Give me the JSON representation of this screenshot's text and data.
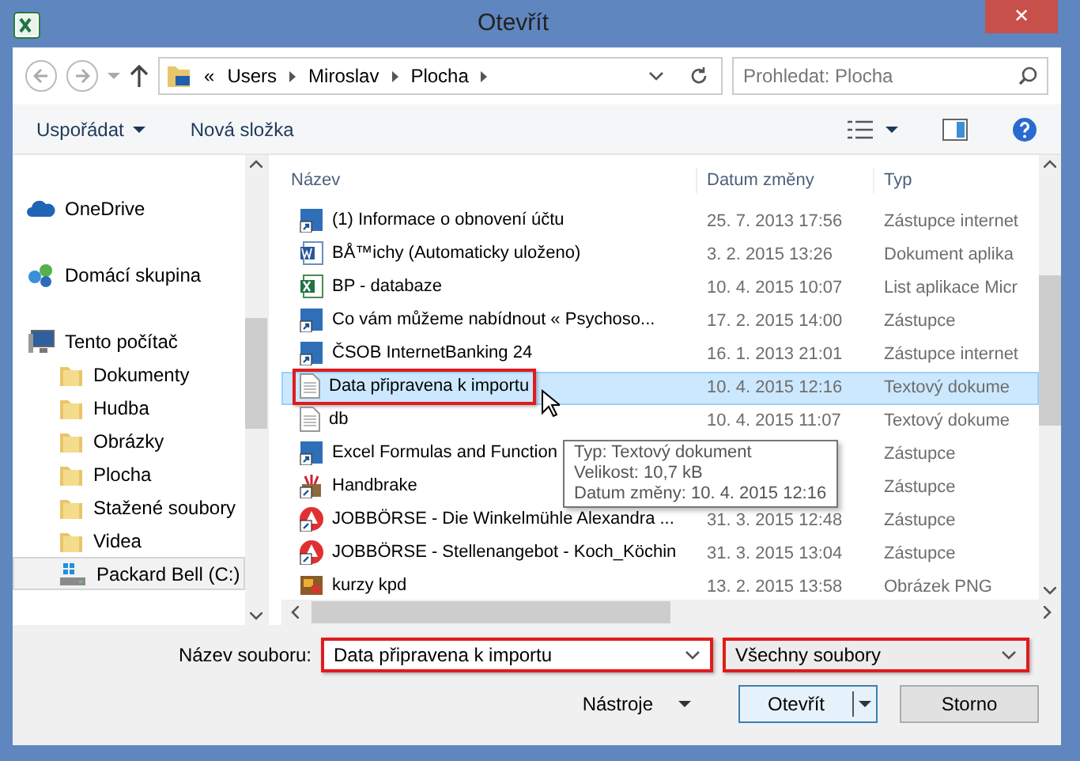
{
  "window": {
    "title": "Otevřít",
    "close": "✕"
  },
  "nav": {
    "path": [
      "Users",
      "Miroslav",
      "Plocha"
    ],
    "overflow": "«",
    "search": {
      "placeholder": "Prohledat: Plocha"
    }
  },
  "commands": [
    {
      "label": "Uspořádat",
      "dropdown": true
    },
    {
      "label": "Nová složka",
      "dropdown": false
    }
  ],
  "sidebar": {
    "items": [
      {
        "label": "OneDrive",
        "kind": "cloud",
        "selected": false
      },
      {
        "label": "Domácí skupina",
        "kind": "homegroup",
        "selected": false
      },
      {
        "label": "Tento počítač",
        "kind": "computer",
        "selected": false,
        "children": [
          {
            "label": "Dokumenty",
            "kind": "folder",
            "selected": false
          },
          {
            "label": "Hudba",
            "kind": "folder",
            "selected": false
          },
          {
            "label": "Obrázky",
            "kind": "folder",
            "selected": false
          },
          {
            "label": "Plocha",
            "kind": "folder",
            "selected": false
          },
          {
            "label": "Stažené soubory",
            "kind": "folder",
            "selected": false
          },
          {
            "label": "Videa",
            "kind": "folder",
            "selected": false
          },
          {
            "label": "Packard Bell (C:)",
            "kind": "drive",
            "selected": true
          }
        ]
      }
    ]
  },
  "table": {
    "columns": [
      "Název",
      "Datum změny",
      "Typ"
    ],
    "rows": [
      {
        "name": "(1) Informace o obnovení účtu",
        "date": "25. 7. 2013 17:56",
        "type": "Zástupce internet",
        "kind": "shortcut",
        "selected": false,
        "annotated": false
      },
      {
        "name": "BÅ™ichy (Automaticky uloženo)",
        "date": "3. 2. 2015 13:26",
        "type": "Dokument aplika",
        "kind": "word",
        "selected": false,
        "annotated": false
      },
      {
        "name": "BP - databaze",
        "date": "10. 4. 2015 10:07",
        "type": "List aplikace Micr",
        "kind": "excel",
        "selected": false,
        "annotated": false
      },
      {
        "name": "Co vám můžeme nabídnout « Psychoso...",
        "date": "17. 2. 2015 14:00",
        "type": "Zástupce",
        "kind": "shortcut",
        "selected": false,
        "annotated": false
      },
      {
        "name": "ČSOB InternetBanking 24",
        "date": "16. 1. 2013 21:01",
        "type": "Zástupce internet",
        "kind": "shortcut",
        "selected": false,
        "annotated": false
      },
      {
        "name": "Data připravena k importu",
        "date": "10. 4. 2015 12:16",
        "type": "Textový dokume",
        "kind": "text",
        "selected": true,
        "annotated": true
      },
      {
        "name": "db",
        "date": "10. 4. 2015 11:07",
        "type": "Textový dokume",
        "kind": "text",
        "selected": false,
        "annotated": false
      },
      {
        "name": "Excel Formulas and Function",
        "type": "Zástupce",
        "kind": "shortcut",
        "selected": false,
        "annotated": false
      },
      {
        "name": "Handbrake",
        "type": "Zástupce",
        "kind": "app",
        "selected": false,
        "annotated": false
      },
      {
        "name": "JOBBÖRSE - Die Winkelmühle Alexandra ...",
        "date": "31. 3. 2015 12:48",
        "type": "Zástupce",
        "kind": "alert",
        "selected": false,
        "annotated": false
      },
      {
        "name": "JOBBÖRSE - Stellenangebot - Koch_Köchin",
        "date": "31. 3. 2015 13:04",
        "type": "Zástupce",
        "kind": "alert",
        "selected": false,
        "annotated": false
      },
      {
        "name": "kurzy kpd",
        "date": "13. 2. 2015 13:58",
        "type": "Obrázek PNG",
        "kind": "image",
        "selected": false,
        "annotated": false
      }
    ]
  },
  "tooltip": [
    "Typ: Textový dokument",
    "Velikost: 10,7 kB",
    "Datum změny: 10. 4. 2015 12:16"
  ],
  "footer": {
    "filename_label": "Název souboru:",
    "filename": {
      "value": "Data připravena k importu",
      "annotated": true
    },
    "filter": {
      "value": "Všechny soubory",
      "annotated": true
    },
    "tools": "Nástroje",
    "open": "Otevřít",
    "cancel": "Storno"
  }
}
